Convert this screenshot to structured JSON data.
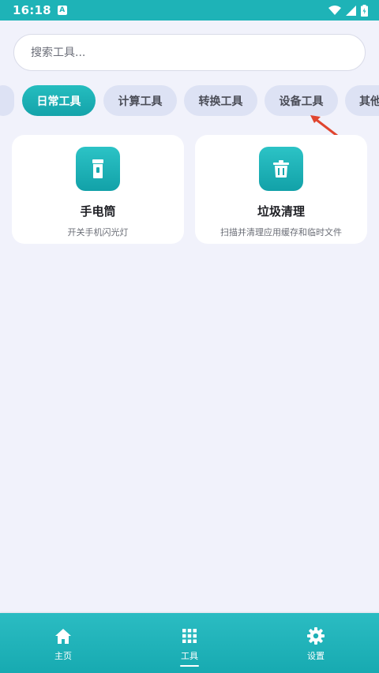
{
  "status_bar": {
    "time": "16:18",
    "notification_icon": "A"
  },
  "search": {
    "placeholder": "搜索工具..."
  },
  "tabs": [
    {
      "label": "日常工具",
      "active": true
    },
    {
      "label": "计算工具",
      "active": false
    },
    {
      "label": "转换工具",
      "active": false
    },
    {
      "label": "设备工具",
      "active": false
    },
    {
      "label": "其他工具",
      "active": false
    }
  ],
  "tools": [
    {
      "title": "手电筒",
      "description": "开关手机闪光灯",
      "icon": "flashlight-icon"
    },
    {
      "title": "垃圾清理",
      "description": "扫描并清理应用缓存和临时文件",
      "icon": "trash-icon"
    }
  ],
  "bottom_nav": [
    {
      "label": "主页",
      "icon": "home-icon",
      "active": false
    },
    {
      "label": "工具",
      "icon": "grid-icon",
      "active": true
    },
    {
      "label": "设置",
      "icon": "gear-icon",
      "active": false
    }
  ],
  "colors": {
    "accent": "#1eb3b7",
    "background": "#f1f2fb",
    "tab_inactive": "#dde2f4",
    "annotation_arrow": "#e0452f"
  }
}
